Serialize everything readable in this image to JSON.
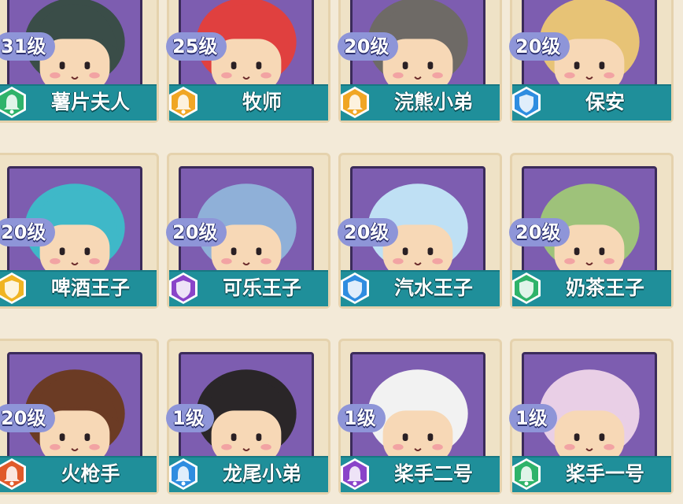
{
  "characters": [
    {
      "name": "薯片夫人",
      "level": "31级",
      "rank_color": "#2fb36a",
      "hair": "#3a4d48",
      "skin": "#f7d8b6",
      "accent": "#8fbf52",
      "icon": "bell-icon"
    },
    {
      "name": "牧师",
      "level": "25级",
      "rank_color": "#f0a624",
      "hair": "#e0403f",
      "skin": "#f7d8b6",
      "accent": "#ffffff",
      "icon": "bell-icon"
    },
    {
      "name": "浣熊小弟",
      "level": "20级",
      "rank_color": "#f0a624",
      "hair": "#6e6a66",
      "skin": "#f7d8b6",
      "accent": "#4b6b40",
      "icon": "bell-icon"
    },
    {
      "name": "保安",
      "level": "20级",
      "rank_color": "#2f8de0",
      "hair": "#e7c376",
      "skin": "#f7d8b6",
      "accent": "#2a3d6b",
      "icon": "shield-icon"
    },
    {
      "name": "啤酒王子",
      "level": "20级",
      "rank_color": "#f0b423",
      "hair": "#3fb8c8",
      "skin": "#f7d8b6",
      "accent": "#f1d66a",
      "icon": "shield-icon"
    },
    {
      "name": "可乐王子",
      "level": "20级",
      "rank_color": "#8a44c9",
      "hair": "#8fb0d8",
      "skin": "#f7d8b6",
      "accent": "#d93a3a",
      "icon": "shield-icon"
    },
    {
      "name": "汽水王子",
      "level": "20级",
      "rank_color": "#2f8de0",
      "hair": "#bfe0f4",
      "skin": "#f7d8b6",
      "accent": "#2f4fa0",
      "icon": "shield-icon"
    },
    {
      "name": "奶茶王子",
      "level": "20级",
      "rank_color": "#2fb36a",
      "hair": "#9ec27a",
      "skin": "#f7d8b6",
      "accent": "#e8e4d8",
      "icon": "shield-icon"
    },
    {
      "name": "火枪手",
      "level": "20级",
      "rank_color": "#e05a2a",
      "hair": "#6b3b24",
      "skin": "#f7d8b6",
      "accent": "#9a5a34",
      "icon": "bell-icon"
    },
    {
      "name": "龙尾小弟",
      "level": "1级",
      "rank_color": "#2f8de0",
      "hair": "#2a2628",
      "skin": "#f7d8b6",
      "accent": "#3a3a3a",
      "icon": "bell-icon"
    },
    {
      "name": "桨手二号",
      "level": "1级",
      "rank_color": "#8a44c9",
      "hair": "#f2f2f2",
      "skin": "#f7d8b6",
      "accent": "#2a2628",
      "icon": "bell-icon"
    },
    {
      "name": "桨手一号",
      "level": "1级",
      "rank_color": "#2fb36a",
      "hair": "#e9cfe6",
      "skin": "#f7d8b6",
      "accent": "#b8283a",
      "icon": "bell-icon"
    }
  ]
}
